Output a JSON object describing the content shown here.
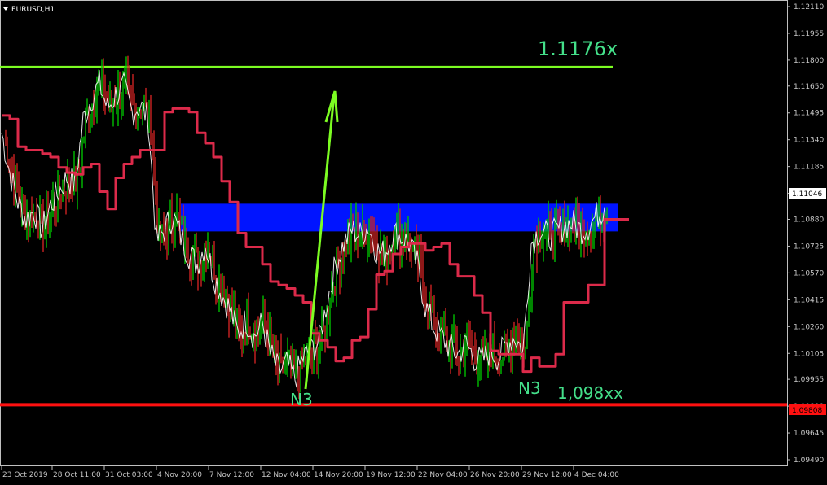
{
  "window": {
    "title": "EURUSD,H1"
  },
  "chart_data": {
    "type": "line",
    "title": "EURUSD,H1",
    "colors": {
      "background": "#000000",
      "frame": "#c0c0c0",
      "price_line": "#ffffff",
      "bull_candle": "#00c000",
      "bear_candle": "#cc2222",
      "channel": "#dc2a4a",
      "zone": "#0014ff",
      "resistance": "#7cfc22",
      "support": "#ff1010",
      "annotation": "#44e08a",
      "arrow": "#7cfc22"
    },
    "y_axis": {
      "ylim": [
        1.0949,
        1.1211
      ],
      "ticks": [
        "1.12110",
        "1.11955",
        "1.11800",
        "1.11650",
        "1.11495",
        "1.11340",
        "1.11185",
        "1.11030",
        "1.10880",
        "1.10725",
        "1.10570",
        "1.10415",
        "1.10260",
        "1.10105",
        "1.09955",
        "1.09800",
        "1.09645",
        "1.09490"
      ]
    },
    "x_axis": {
      "ticks": [
        "23 Oct 2019",
        "28 Oct 11:00",
        "31 Oct 03:00",
        "4 Nov 20:00",
        "7 Nov 12:00",
        "12 Nov 04:00",
        "14 Nov 20:00",
        "19 Nov 12:00",
        "22 Nov 04:00",
        "26 Nov 20:00",
        "29 Nov 12:00",
        "4 Dec 04:00"
      ]
    },
    "current_price": "1.11046",
    "support_price_label": "1.09808",
    "levels": {
      "resistance": 1.1176,
      "support": 1.09808,
      "zone_top": 1.1097,
      "zone_bottom": 1.1081
    },
    "annotations": {
      "resistance_label": "1.1176x",
      "support_label": "1,098xx",
      "wave_label_1": "N3",
      "wave_label_2": "N3"
    },
    "series": [
      {
        "values": [
          [
            0,
            1.1138
          ],
          [
            10,
            1.1115
          ],
          [
            20,
            1.1098
          ],
          [
            30,
            1.1088
          ],
          [
            40,
            1.1093
          ],
          [
            50,
            1.1082
          ],
          [
            60,
            1.1096
          ],
          [
            70,
            1.1104
          ],
          [
            80,
            1.1112
          ],
          [
            90,
            1.1108
          ],
          [
            100,
            1.1145
          ],
          [
            110,
            1.1158
          ],
          [
            120,
            1.1166
          ],
          [
            130,
            1.1152
          ],
          [
            140,
            1.116
          ],
          [
            150,
            1.1164
          ],
          [
            160,
            1.115
          ],
          [
            170,
            1.1154
          ],
          [
            180,
            1.1146
          ],
          [
            190,
            1.1075
          ],
          [
            200,
            1.1082
          ],
          [
            210,
            1.109
          ],
          [
            220,
            1.1078
          ],
          [
            230,
            1.1068
          ],
          [
            240,
            1.1062
          ],
          [
            250,
            1.1074
          ],
          [
            260,
            1.1056
          ],
          [
            270,
            1.1045
          ],
          [
            280,
            1.1036
          ],
          [
            290,
            1.1022
          ],
          [
            300,
            1.103
          ],
          [
            310,
            1.102
          ],
          [
            320,
            1.1028
          ],
          [
            330,
            1.101
          ],
          [
            340,
            1.1
          ],
          [
            350,
            1.1004
          ],
          [
            360,
            1.0996
          ],
          [
            370,
            1.1008
          ],
          [
            380,
            1.1012
          ],
          [
            390,
            1.1018
          ],
          [
            400,
            1.1042
          ],
          [
            410,
            1.1062
          ],
          [
            420,
            1.1074
          ],
          [
            430,
            1.1082
          ],
          [
            440,
            1.1079
          ],
          [
            450,
            1.1084
          ],
          [
            460,
            1.107
          ],
          [
            470,
            1.1068
          ],
          [
            480,
            1.108
          ],
          [
            490,
            1.1078
          ],
          [
            500,
            1.1074
          ],
          [
            510,
            1.1062
          ],
          [
            520,
            1.1038
          ],
          [
            530,
            1.1026
          ],
          [
            540,
            1.102
          ],
          [
            550,
            1.1014
          ],
          [
            560,
            1.101
          ],
          [
            570,
            1.1016
          ],
          [
            580,
            1.1008
          ],
          [
            590,
            1.1006
          ],
          [
            600,
            1.1012
          ],
          [
            610,
            1.1008
          ],
          [
            620,
            1.1016
          ],
          [
            630,
            1.102
          ],
          [
            640,
            1.1012
          ],
          [
            650,
            1.1074
          ],
          [
            660,
            1.1082
          ],
          [
            670,
            1.1078
          ],
          [
            680,
            1.108
          ],
          [
            690,
            1.1084
          ],
          [
            700,
            1.1086
          ],
          [
            710,
            1.1082
          ],
          [
            720,
            1.1084
          ],
          [
            730,
            1.109
          ],
          [
            740,
            1.1095
          ]
        ]
      },
      {
        "values": [
          [
            0,
            1.1148
          ],
          [
            10,
            1.1146
          ],
          [
            20,
            1.113
          ],
          [
            30,
            1.1128
          ],
          [
            40,
            1.1128
          ],
          [
            50,
            1.1126
          ],
          [
            60,
            1.1124
          ],
          [
            70,
            1.1118
          ],
          [
            80,
            1.1115
          ],
          [
            90,
            1.1114
          ],
          [
            100,
            1.1118
          ],
          [
            110,
            1.112
          ],
          [
            120,
            1.1104
          ],
          [
            130,
            1.1094
          ],
          [
            140,
            1.1112
          ],
          [
            150,
            1.112
          ],
          [
            160,
            1.1124
          ],
          [
            170,
            1.1128
          ],
          [
            180,
            1.1128
          ],
          [
            190,
            1.1128
          ],
          [
            200,
            1.115
          ],
          [
            210,
            1.1152
          ],
          [
            220,
            1.1152
          ],
          [
            230,
            1.115
          ],
          [
            240,
            1.1138
          ],
          [
            250,
            1.1132
          ],
          [
            260,
            1.1124
          ],
          [
            270,
            1.111
          ],
          [
            280,
            1.1098
          ],
          [
            290,
            1.108
          ],
          [
            300,
            1.1072
          ],
          [
            310,
            1.1072
          ],
          [
            320,
            1.1062
          ],
          [
            330,
            1.1052
          ],
          [
            340,
            1.105
          ],
          [
            350,
            1.1048
          ],
          [
            360,
            1.1044
          ],
          [
            370,
            1.104
          ],
          [
            380,
            1.1022
          ],
          [
            390,
            1.1018
          ],
          [
            400,
            1.1014
          ],
          [
            410,
            1.1006
          ],
          [
            420,
            1.1008
          ],
          [
            430,
            1.1018
          ],
          [
            440,
            1.102
          ],
          [
            450,
            1.1036
          ],
          [
            460,
            1.1056
          ],
          [
            470,
            1.1058
          ],
          [
            480,
            1.1068
          ],
          [
            490,
            1.1072
          ],
          [
            500,
            1.1074
          ],
          [
            510,
            1.1074
          ],
          [
            520,
            1.107
          ],
          [
            530,
            1.1072
          ],
          [
            540,
            1.1074
          ],
          [
            550,
            1.1062
          ],
          [
            560,
            1.1055
          ],
          [
            570,
            1.1055
          ],
          [
            580,
            1.1044
          ],
          [
            590,
            1.1034
          ],
          [
            600,
            1.1012
          ],
          [
            610,
            1.101
          ],
          [
            620,
            1.101
          ],
          [
            630,
            1.101
          ],
          [
            640,
            1.1
          ],
          [
            650,
            1.1008
          ],
          [
            660,
            1.1003
          ],
          [
            670,
            1.1003
          ],
          [
            680,
            1.101
          ],
          [
            690,
            1.104
          ],
          [
            700,
            1.104
          ],
          [
            710,
            1.104
          ],
          [
            720,
            1.105
          ],
          [
            730,
            1.105
          ],
          [
            740,
            1.1088
          ],
          [
            750,
            1.1088
          ],
          [
            770,
            1.1088
          ]
        ]
      }
    ]
  }
}
